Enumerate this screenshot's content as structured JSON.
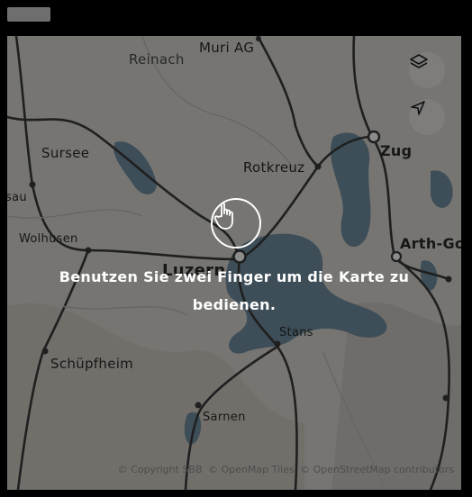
{
  "map": {
    "places": [
      {
        "name": "Muri AG"
      },
      {
        "name": "Reinach"
      },
      {
        "name": "Sursee"
      },
      {
        "name": "Rotkreuz"
      },
      {
        "name": "Zug"
      },
      {
        "name": "Wolhusen"
      },
      {
        "name": "Luzern"
      },
      {
        "name": "Arth-Go"
      },
      {
        "name": "Stans"
      },
      {
        "name": "Schüpfheim"
      },
      {
        "name": "Sarnen"
      },
      {
        "name": "sau"
      }
    ],
    "controls": {
      "layers_icon": "layers-icon",
      "locate_icon": "locate-arrow-icon"
    },
    "hint_text": "Benutzen Sie zwei Finger um die Karte zu bedienen.",
    "hint_icon": "hand-pointer-icon",
    "attribution": [
      "© Copyright SBB",
      "© OpenMap Tiles",
      "© OpenStreetMap contributors"
    ]
  },
  "colors": {
    "water": "#6f8ea0",
    "rail": "#3a3a3a",
    "land": "#d8d6d0"
  }
}
